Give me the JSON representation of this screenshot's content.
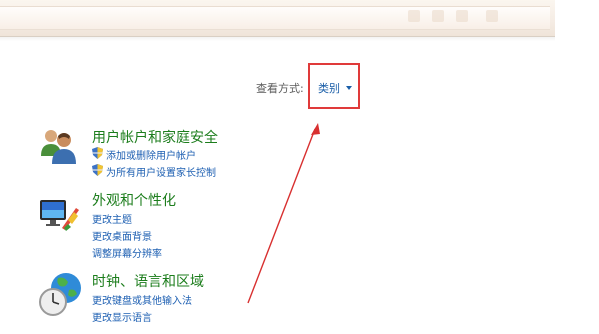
{
  "view": {
    "label": "查看方式:",
    "selected": "类别"
  },
  "categories": [
    {
      "title": "用户帐户和家庭安全",
      "icon": "users-icon",
      "links": [
        "添加或删除用户帐户",
        "为所有用户设置家长控制"
      ]
    },
    {
      "title": "外观和个性化",
      "icon": "appearance-icon",
      "links": [
        "更改主题",
        "更改桌面背景",
        "调整屏幕分辨率"
      ]
    },
    {
      "title": "时钟、语言和区域",
      "icon": "clock-globe-icon",
      "links": [
        "更改键盘或其他输入法",
        "更改显示语言"
      ]
    }
  ],
  "colors": {
    "category_title": "#1c7d1c",
    "link": "#1d5fb2",
    "highlight_box": "#e03a3a",
    "annotation_arrow": "#d83030"
  }
}
